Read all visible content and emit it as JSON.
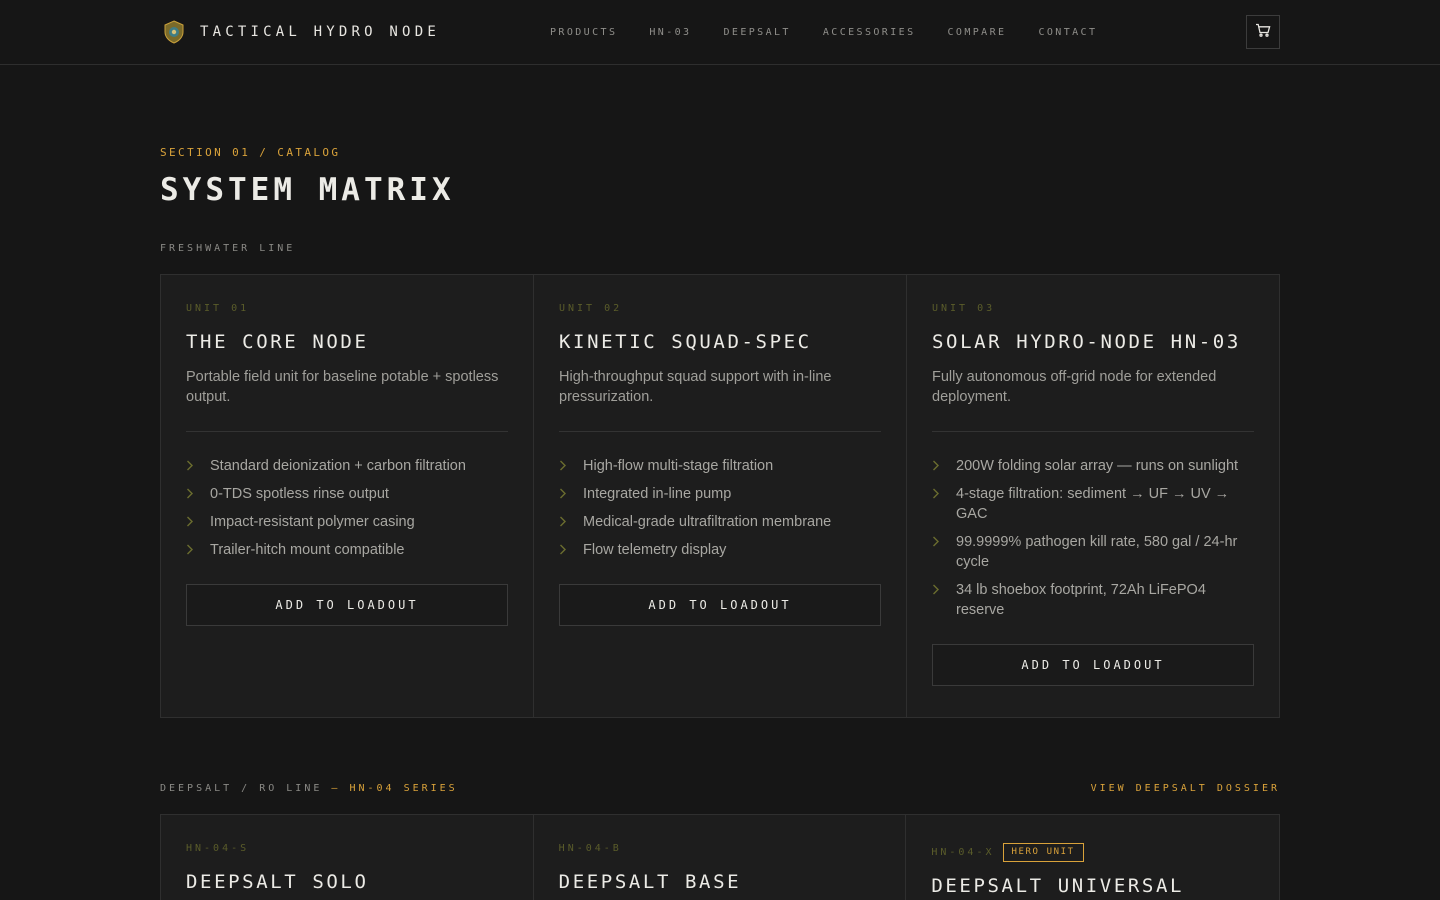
{
  "header": {
    "brand": "TACTICAL HYDRO NODE",
    "logo_icon": "shield-emblem-icon",
    "nav": [
      "PRODUCTS",
      "HN-03",
      "DEEPSALT",
      "ACCESSORIES",
      "COMPARE",
      "CONTACT"
    ],
    "cart_icon": "cart-icon"
  },
  "section": {
    "eyebrow": "SECTION 01 / CATALOG",
    "title": "SYSTEM MATRIX"
  },
  "freshwater": {
    "label": "FRESHWATER LINE",
    "cards": [
      {
        "code": "UNIT 01",
        "title": "THE CORE NODE",
        "desc": "Portable field unit for baseline potable + spotless output.",
        "features": [
          "Standard deionization + carbon filtration",
          "0-TDS spotless rinse output",
          "Impact-resistant polymer casing",
          "Trailer-hitch mount compatible"
        ],
        "button": "ADD TO LOADOUT"
      },
      {
        "code": "UNIT 02",
        "title": "KINETIC SQUAD-SPEC",
        "desc": "High-throughput squad support with in-line pressurization.",
        "features": [
          "High-flow multi-stage filtration",
          "Integrated in-line pump",
          "Medical-grade ultrafiltration membrane",
          "Flow telemetry display"
        ],
        "button": "ADD TO LOADOUT"
      },
      {
        "code": "UNIT 03",
        "title": "SOLAR HYDRO-NODE HN-03",
        "desc": "Fully autonomous off-grid node for extended deployment.",
        "features": [
          "200W folding solar array — runs on sunlight",
          "4-stage filtration: sediment → UF → UV → GAC",
          "99.9999% pathogen kill rate, 580 gal / 24-hr cycle",
          "34 lb shoebox footprint, 72Ah LiFePO4 reserve"
        ],
        "button": "ADD TO LOADOUT"
      }
    ]
  },
  "deepsalt": {
    "label": "DEEPSALT / RO LINE",
    "label_accent": "— HN-04 SERIES",
    "link": "VIEW DEEPSALT DOSSIER",
    "cards": [
      {
        "code": "HN-04-S",
        "title": "DEEPSALT SOLO"
      },
      {
        "code": "HN-04-B",
        "title": "DEEPSALT BASE"
      },
      {
        "code": "HN-04-X",
        "badge": "HERO UNIT",
        "title": "DEEPSALT UNIVERSAL"
      }
    ]
  },
  "colors": {
    "accent": "#d9a23a",
    "unit_code": "#5a5c2a",
    "chevron": "#6b6d2e",
    "background": "#161616",
    "card_bg": "#1d1d1d"
  }
}
